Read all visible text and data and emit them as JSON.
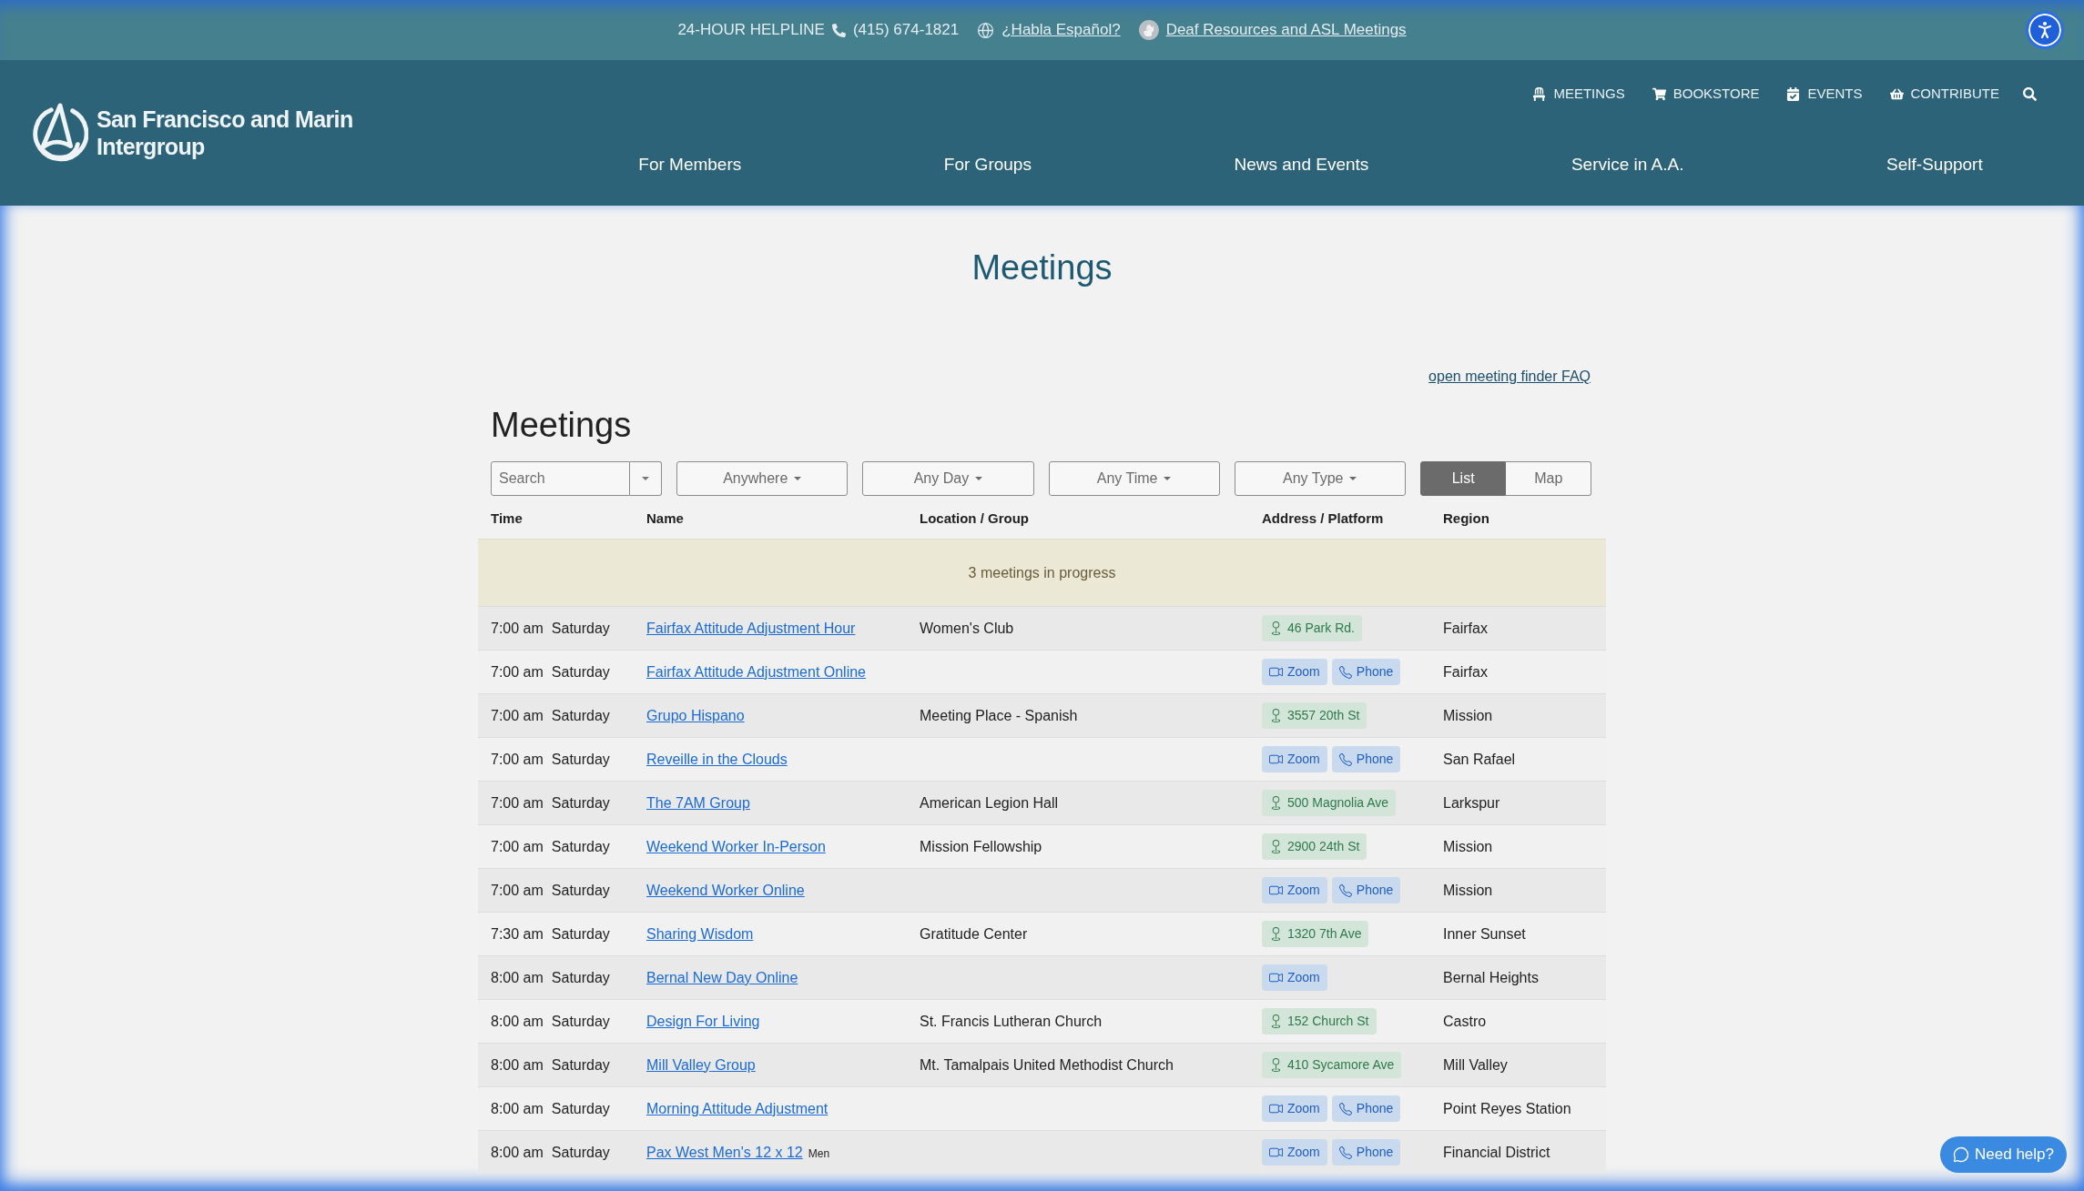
{
  "helpline_bar": {
    "label": "24-HOUR HELPLINE",
    "phone": "(415) 674-1821",
    "links": [
      {
        "kind": "language",
        "label": "¿Habla Español?"
      },
      {
        "kind": "deaf",
        "label": "Deaf Resources and ASL Meetings"
      }
    ]
  },
  "header": {
    "logo": {
      "lines": [
        "San Francisco and Marin",
        "Intergroup"
      ]
    },
    "utility_nav": [
      {
        "kind": "meetings",
        "label": "MEETINGS"
      },
      {
        "kind": "bookstore",
        "label": "BOOKSTORE"
      },
      {
        "kind": "events",
        "label": "EVENTS"
      },
      {
        "kind": "contribute",
        "label": "CONTRIBUTE"
      }
    ],
    "main_nav": [
      "For Members",
      "For Groups",
      "News and Events",
      "Service in A.A.",
      "Self-Support"
    ]
  },
  "page_title": "Meetings",
  "faq_link": "open meeting finder FAQ",
  "finder": {
    "title": "Meetings",
    "search": {
      "placeholder": "Search"
    },
    "filters": [
      "Anywhere",
      "Any Day",
      "Any Time",
      "Any Type"
    ],
    "view_toggle": [
      {
        "label": "List",
        "selected": true
      },
      {
        "label": "Map",
        "selected": false
      }
    ],
    "columns": [
      "Time",
      "Name",
      "Location / Group",
      "Address / Platform",
      "Region"
    ],
    "in_progress": "3 meetings in progress",
    "rows": [
      {
        "time": "7:00 am",
        "day": "Saturday",
        "name": "Fairfax Attitude Adjustment Hour",
        "location": "Women's Club",
        "platform": [
          {
            "kind": "address",
            "label": "46 Park Rd."
          }
        ],
        "region": "Fairfax"
      },
      {
        "time": "7:00 am",
        "day": "Saturday",
        "name": "Fairfax Attitude Adjustment Online",
        "platform": [
          {
            "kind": "zoom",
            "label": "Zoom"
          },
          {
            "kind": "phone",
            "label": "Phone"
          }
        ],
        "region": "Fairfax"
      },
      {
        "time": "7:00 am",
        "day": "Saturday",
        "name": "Grupo Hispano",
        "location": "Meeting Place - Spanish",
        "platform": [
          {
            "kind": "address",
            "label": "3557 20th St"
          }
        ],
        "region": "Mission"
      },
      {
        "time": "7:00 am",
        "day": "Saturday",
        "name": "Reveille in the Clouds",
        "platform": [
          {
            "kind": "zoom",
            "label": "Zoom"
          },
          {
            "kind": "phone",
            "label": "Phone"
          }
        ],
        "region": "San Rafael"
      },
      {
        "time": "7:00 am",
        "day": "Saturday",
        "name": "The 7AM Group",
        "location": "American Legion Hall",
        "platform": [
          {
            "kind": "address",
            "label": "500 Magnolia Ave"
          }
        ],
        "region": "Larkspur"
      },
      {
        "time": "7:00 am",
        "day": "Saturday",
        "name": "Weekend Worker In-Person",
        "location": "Mission Fellowship",
        "platform": [
          {
            "kind": "address",
            "label": "2900 24th St"
          }
        ],
        "region": "Mission"
      },
      {
        "time": "7:00 am",
        "day": "Saturday",
        "name": "Weekend Worker Online",
        "platform": [
          {
            "kind": "zoom",
            "label": "Zoom"
          },
          {
            "kind": "phone",
            "label": "Phone"
          }
        ],
        "region": "Mission"
      },
      {
        "time": "7:30 am",
        "day": "Saturday",
        "name": "Sharing Wisdom",
        "location": "Gratitude Center",
        "platform": [
          {
            "kind": "address",
            "label": "1320 7th Ave"
          }
        ],
        "region": "Inner Sunset"
      },
      {
        "time": "8:00 am",
        "day": "Saturday",
        "name": "Bernal New Day Online",
        "platform": [
          {
            "kind": "zoom",
            "label": "Zoom"
          }
        ],
        "region": "Bernal Heights"
      },
      {
        "time": "8:00 am",
        "day": "Saturday",
        "name": "Design For Living",
        "location": "St. Francis Lutheran Church",
        "platform": [
          {
            "kind": "address",
            "label": "152 Church St"
          }
        ],
        "region": "Castro"
      },
      {
        "time": "8:00 am",
        "day": "Saturday",
        "name": "Mill Valley Group",
        "location": "Mt. Tamalpais United Methodist Church",
        "platform": [
          {
            "kind": "address",
            "label": "410 Sycamore Ave"
          }
        ],
        "region": "Mill Valley"
      },
      {
        "time": "8:00 am",
        "day": "Saturday",
        "name": "Morning Attitude Adjustment",
        "platform": [
          {
            "kind": "zoom",
            "label": "Zoom"
          },
          {
            "kind": "phone",
            "label": "Phone"
          }
        ],
        "region": "Point Reyes Station"
      },
      {
        "time": "8:00 am",
        "day": "Saturday",
        "name": "Pax West Men's 12 x 12",
        "tag": "Men",
        "platform": [
          {
            "kind": "zoom",
            "label": "Zoom"
          },
          {
            "kind": "phone",
            "label": "Phone"
          }
        ],
        "region": "Financial District"
      }
    ]
  },
  "help_button": "Need help?"
}
